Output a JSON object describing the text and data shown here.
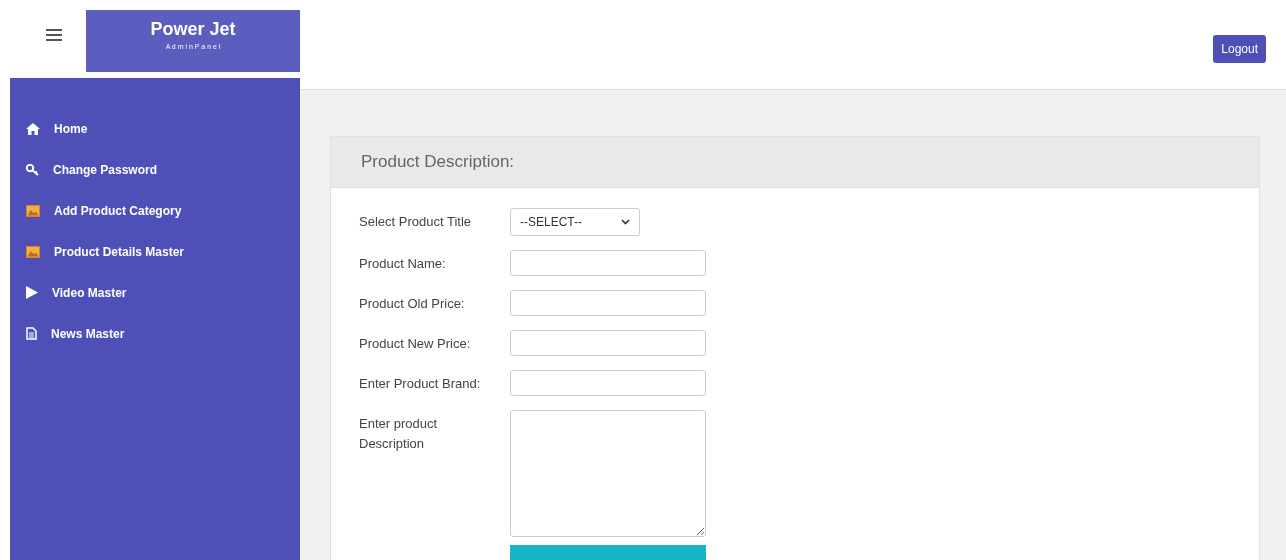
{
  "brand": {
    "title": "Power Jet",
    "subtitle": "A d m i n P a n e l"
  },
  "logout": "Logout",
  "sidebar": {
    "items": [
      {
        "label": "Home"
      },
      {
        "label": "Change Password"
      },
      {
        "label": "Add Product Category"
      },
      {
        "label": "Product Details Master"
      },
      {
        "label": "Video Master"
      },
      {
        "label": "News Master"
      }
    ]
  },
  "card": {
    "title": "Product Description:",
    "fields": [
      {
        "label": "Select Product Title",
        "kind": "select",
        "value": "--SELECT--"
      },
      {
        "label": "Product Name:",
        "kind": "input"
      },
      {
        "label": "Product Old Price:",
        "kind": "input"
      },
      {
        "label": "Product New Price:",
        "kind": "input"
      },
      {
        "label": "Enter Product Brand:",
        "kind": "input"
      },
      {
        "label": "Enter product Description",
        "kind": "textarea"
      }
    ]
  }
}
